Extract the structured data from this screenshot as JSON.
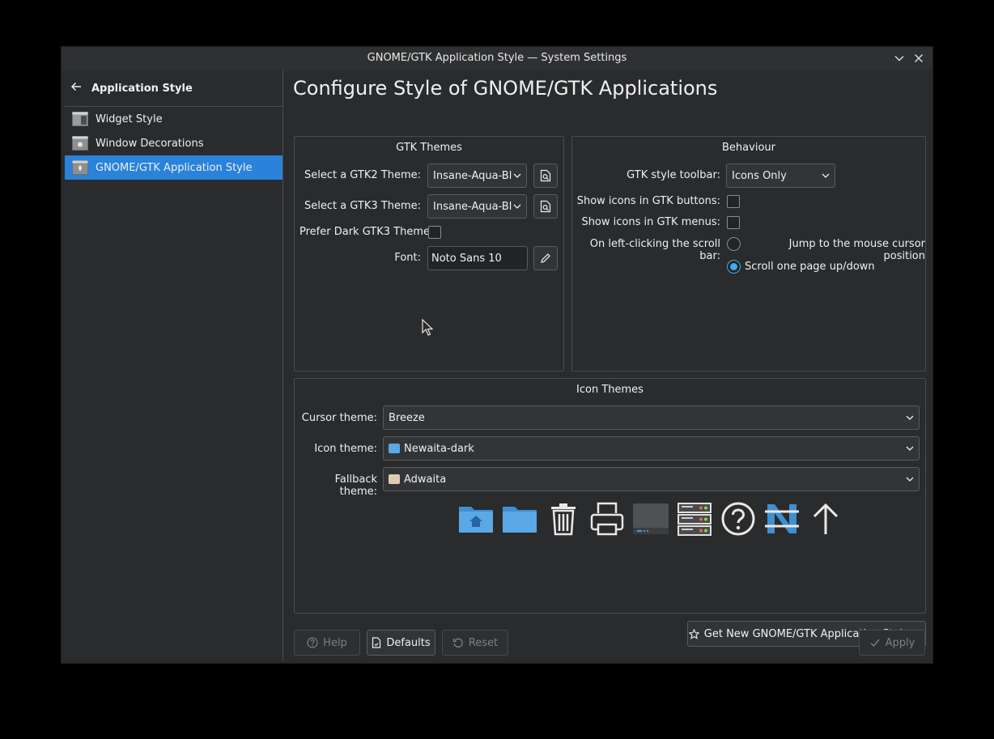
{
  "window": {
    "title": "GNOME/GTK Application Style — System Settings",
    "minimize_icon": "chevron-down-icon",
    "close_icon": "close-icon"
  },
  "sidebar": {
    "back_label": "Application Style",
    "items": [
      {
        "label": "Widget Style",
        "icon": "widget-style-icon"
      },
      {
        "label": "Window Decorations",
        "icon": "window-decorations-icon"
      },
      {
        "label": "GNOME/GTK Application Style",
        "icon": "gtk-style-icon",
        "active": true
      }
    ]
  },
  "main": {
    "title": "Configure Style of GNOME/GTK Applications",
    "gtk_themes": {
      "title": "GTK Themes",
      "gtk2_label": "Select a GTK2 Theme:",
      "gtk2_value": "Insane-Aqua-Blu",
      "gtk3_label": "Select a GTK3 Theme:",
      "gtk3_value": "Insane-Aqua-Blu",
      "prefer_dark_label": "Prefer Dark GTK3 Theme",
      "prefer_dark_checked": false,
      "font_label": "Font:",
      "font_value": "Noto Sans 10"
    },
    "behaviour": {
      "title": "Behaviour",
      "toolbar_label": "GTK style toolbar:",
      "toolbar_value": "Icons Only",
      "icons_buttons_label": "Show icons in GTK buttons:",
      "icons_buttons_checked": false,
      "icons_menus_label": "Show icons in GTK menus:",
      "icons_menus_checked": false,
      "scrollbar_label": "On left-clicking the scroll bar:",
      "scroll_option_jump": "Jump to the mouse cursor position",
      "scroll_option_page": "Scroll one page up/down",
      "scroll_selected": "page"
    },
    "icon_themes": {
      "title": "Icon Themes",
      "cursor_label": "Cursor theme:",
      "cursor_value": "Breeze",
      "icon_label": "Icon theme:",
      "icon_value": "Newaita-dark",
      "fallback_label": "Fallback theme:",
      "fallback_value": "Adwaita",
      "preview_icons": [
        "home-folder-icon",
        "folder-icon",
        "trash-icon",
        "printer-icon",
        "drive-icon",
        "server-icon",
        "help-icon",
        "newaita-logo-icon",
        "go-up-icon"
      ]
    },
    "get_new_label": "Get New GNOME/GTK Application Styles..."
  },
  "footer": {
    "help_label": "Help",
    "defaults_label": "Defaults",
    "reset_label": "Reset",
    "apply_label": "Apply"
  },
  "colors": {
    "accent": "#2a82da",
    "radio_accent": "#3daee9",
    "window_bg": "#2a2b2c",
    "folder_blue": "#5aa9e6",
    "folder_beige": "#e0cbb0"
  }
}
